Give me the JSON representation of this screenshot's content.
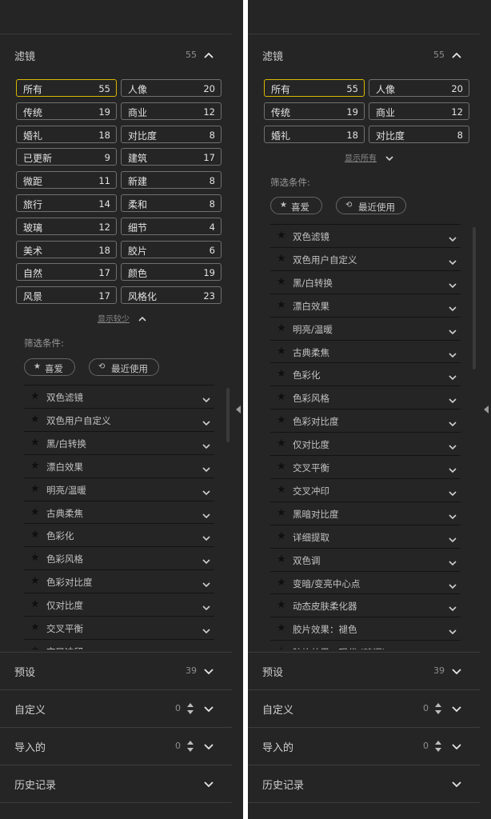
{
  "colors": {
    "panel_bg": "#252525",
    "selected_border": "#d8b800",
    "cell_border": "#707070",
    "text": "#e2e2e2",
    "muted": "#8e8e8e"
  },
  "filters_section": {
    "title": "滤镜",
    "count": "55"
  },
  "categories_full": [
    {
      "label": "所有",
      "count": "55",
      "selected": true
    },
    {
      "label": "人像",
      "count": "20"
    },
    {
      "label": "传统",
      "count": "19"
    },
    {
      "label": "商业",
      "count": "12"
    },
    {
      "label": "婚礼",
      "count": "18"
    },
    {
      "label": "对比度",
      "count": "8"
    },
    {
      "label": "已更新",
      "count": "9"
    },
    {
      "label": "建筑",
      "count": "17"
    },
    {
      "label": "微距",
      "count": "11"
    },
    {
      "label": "新建",
      "count": "8"
    },
    {
      "label": "旅行",
      "count": "14"
    },
    {
      "label": "柔和",
      "count": "8"
    },
    {
      "label": "玻璃",
      "count": "12"
    },
    {
      "label": "细节",
      "count": "4"
    },
    {
      "label": "美术",
      "count": "18"
    },
    {
      "label": "胶片",
      "count": "6"
    },
    {
      "label": "自然",
      "count": "17"
    },
    {
      "label": "颜色",
      "count": "19"
    },
    {
      "label": "风景",
      "count": "17"
    },
    {
      "label": "风格化",
      "count": "23"
    }
  ],
  "show_less_label": "显示较少",
  "show_all_label": "显示所有",
  "filter_conditions_label": "筛选条件:",
  "favorites_pill": {
    "icon": "star-icon",
    "label": "喜爱"
  },
  "recent_pill": {
    "icon": "history-icon",
    "label": "最近使用"
  },
  "filter_list_left": [
    "双色滤镜",
    "双色用户自定义",
    "黑/白转换",
    "漂白效果",
    "明亮/温暖",
    "古典柔焦",
    "色彩化",
    "色彩风格",
    "色彩对比度",
    "仅对比度",
    "交叉平衡",
    "交叉冲印"
  ],
  "filter_list_right": [
    "双色滤镜",
    "双色用户自定义",
    "黑/白转换",
    "漂白效果",
    "明亮/温暖",
    "古典柔焦",
    "色彩化",
    "色彩风格",
    "色彩对比度",
    "仅对比度",
    "交叉平衡",
    "交叉冲印",
    "黑暗对比度",
    "详细提取",
    "双色调",
    "变暗/变亮中心点",
    "动态皮肤柔化器",
    "胶片效果：褪色",
    "胶片效果：现代 (暗调)"
  ],
  "presets_section": {
    "title": "预设",
    "count": "39"
  },
  "custom_section": {
    "title": "自定义",
    "count": "0"
  },
  "imported_section": {
    "title": "导入的",
    "count": "0"
  },
  "history_section": {
    "title": "历史记录"
  }
}
